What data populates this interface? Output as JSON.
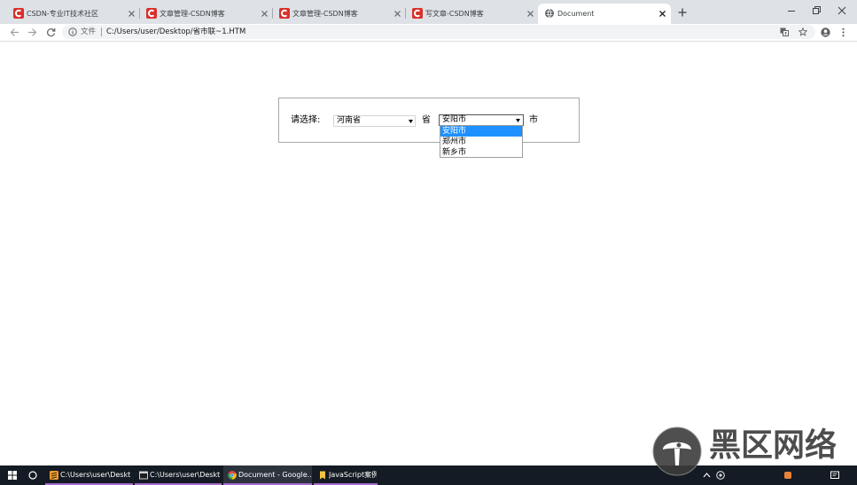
{
  "browser": {
    "tabs": [
      {
        "title": "CSDN-专业IT技术社区",
        "icon": "csdn-icon",
        "active": false
      },
      {
        "title": "文章管理-CSDN博客",
        "icon": "csdn-icon",
        "active": false
      },
      {
        "title": "文章管理-CSDN博客",
        "icon": "csdn-icon",
        "active": false
      },
      {
        "title": "写文章-CSDN博客",
        "icon": "csdn-icon",
        "active": false
      },
      {
        "title": "Document",
        "icon": "globe-icon",
        "active": true
      }
    ],
    "address": {
      "scheme_label": "文件",
      "path": "C:/Users/user/Desktop/省市联~1.HTM"
    }
  },
  "page": {
    "prompt_label": "请选择:",
    "province_select": {
      "value": "河南省"
    },
    "province_unit": "省",
    "city_select": {
      "value": "安阳市",
      "expanded": true,
      "options": [
        "安阳市",
        "郑州市",
        "新乡市"
      ],
      "highlighted_index": 0
    },
    "city_unit": "市"
  },
  "taskbar": {
    "items": [
      {
        "label": "C:\\Users\\user\\Deskt...",
        "icon": "sublime-icon",
        "active": false
      },
      {
        "label": "C:\\Users\\user\\Deskt...",
        "icon": "console-icon",
        "active": false
      },
      {
        "label": "Document - Google...",
        "icon": "chrome-icon",
        "active": true
      },
      {
        "label": "JavaScript案例",
        "icon": "folder-icon",
        "active": false
      }
    ]
  },
  "watermark": {
    "text": "黑区网络",
    "icon": "mushroom-logo-icon"
  },
  "colors": {
    "tabstrip": "#dee1e6",
    "csdn_red": "#d8302a",
    "dropdown_highlight": "#1e90ff",
    "taskbar": "#141b24",
    "task_indicator": "#a86ccc"
  }
}
